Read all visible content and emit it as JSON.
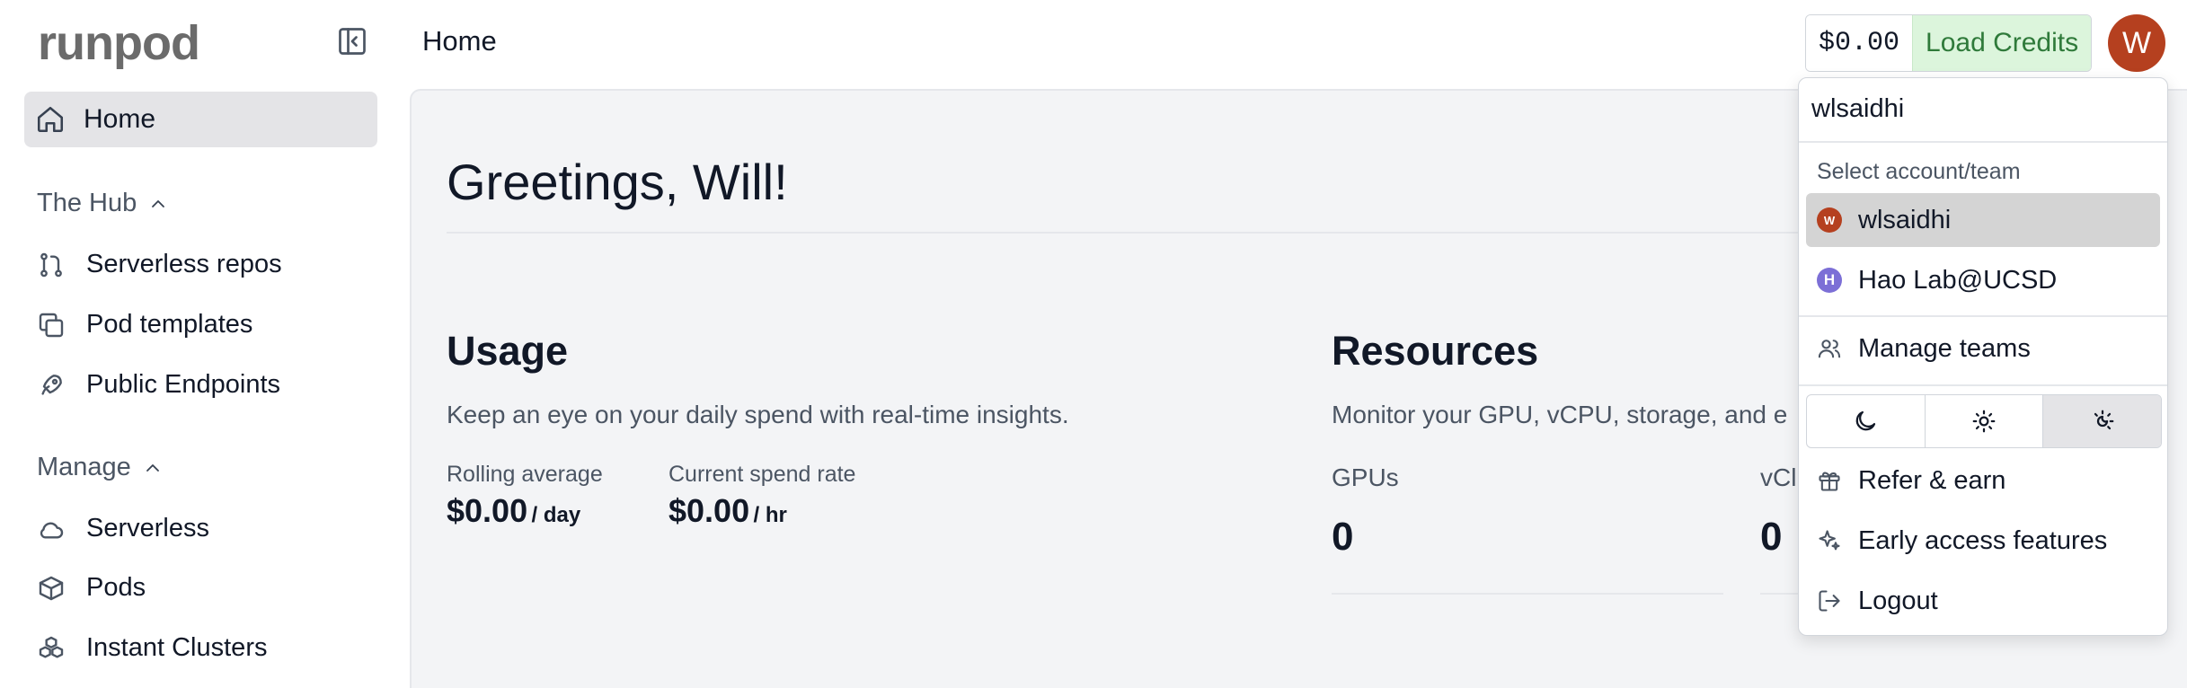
{
  "brand": {
    "logo": "runpod"
  },
  "header": {
    "title": "Home"
  },
  "credits": {
    "amount": "$0.00",
    "load_label": "Load Credits"
  },
  "user": {
    "avatar_letter": "W"
  },
  "sidebar": {
    "home_label": "Home",
    "sections": [
      {
        "title": "The Hub",
        "items": [
          {
            "label": "Serverless repos",
            "icon": "git-branch-icon"
          },
          {
            "label": "Pod templates",
            "icon": "copy-icon"
          },
          {
            "label": "Public Endpoints",
            "icon": "rocket-icon"
          }
        ]
      },
      {
        "title": "Manage",
        "items": [
          {
            "label": "Serverless",
            "icon": "cloud-icon"
          },
          {
            "label": "Pods",
            "icon": "box-icon"
          },
          {
            "label": "Instant Clusters",
            "icon": "boxes-icon"
          }
        ]
      }
    ]
  },
  "main": {
    "greeting": "Greetings, Will!",
    "usage": {
      "title": "Usage",
      "description": "Keep an eye on your daily spend with real-time insights.",
      "rolling_label": "Rolling average",
      "rolling_value": "$0.00",
      "rolling_unit": "/ day",
      "spend_label": "Current spend rate",
      "spend_value": "$0.00",
      "spend_unit": "/ hr"
    },
    "resources": {
      "title": "Resources",
      "description": "Monitor your GPU, vCPU, storage, and e",
      "gpus_label": "GPUs",
      "gpus_value": "0",
      "vcpu_label": "vCl",
      "vcpu_value": "0"
    }
  },
  "dropdown": {
    "username": "wlsaidhi",
    "select_label": "Select account/team",
    "accounts": [
      {
        "name": "wlsaidhi",
        "initial": "W",
        "color": "#b5401f",
        "selected": true
      },
      {
        "name": "Hao Lab@UCSD",
        "initial": "H",
        "color": "#7c6fd6",
        "selected": false
      }
    ],
    "manage_teams": "Manage teams",
    "theme_options": [
      "dark",
      "light",
      "system"
    ],
    "theme_selected": "system",
    "refer": "Refer & earn",
    "early_access": "Early access features",
    "logout": "Logout"
  }
}
